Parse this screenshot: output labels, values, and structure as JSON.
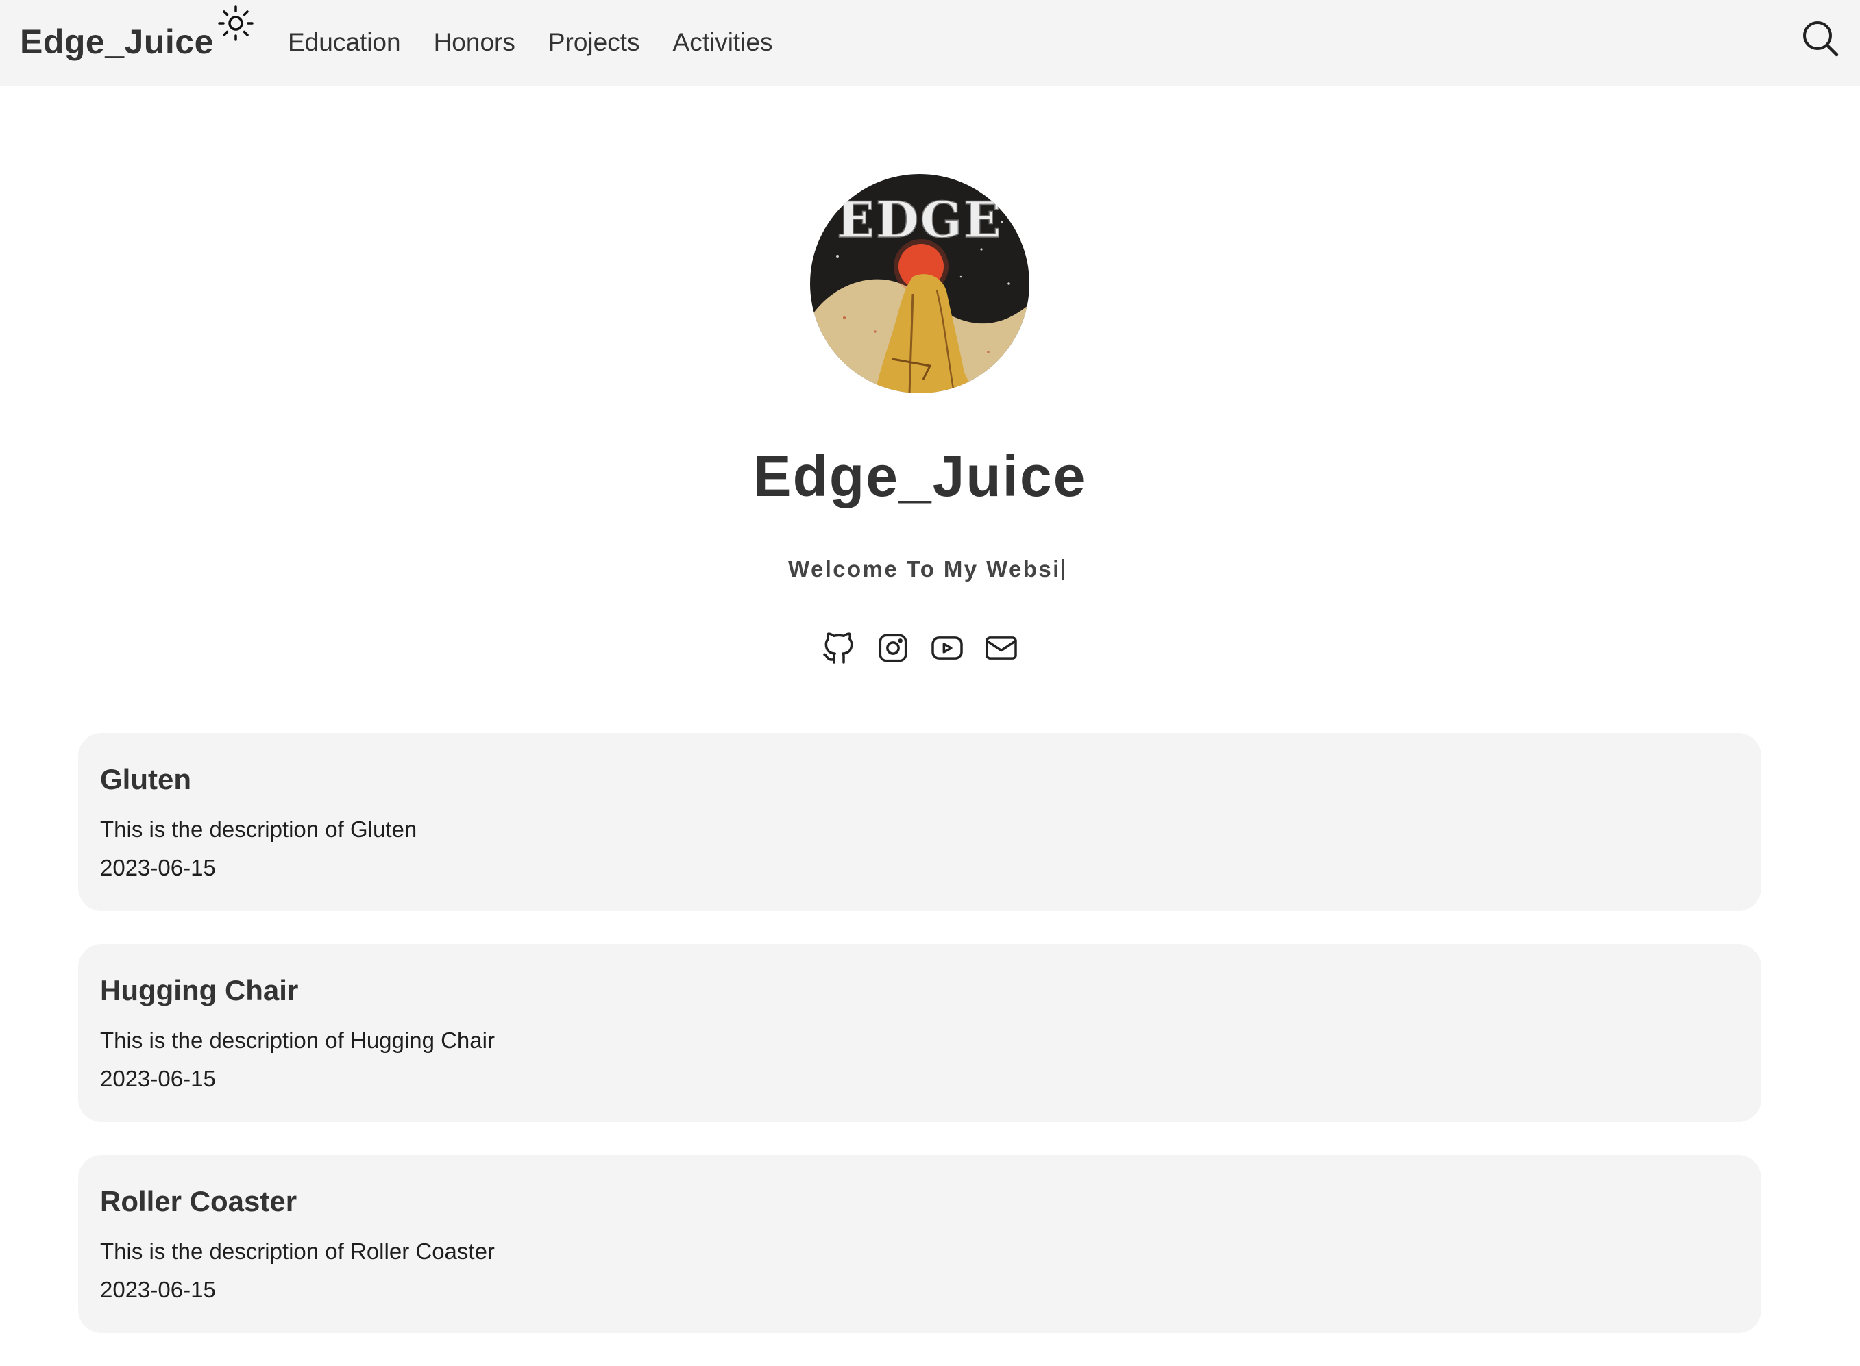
{
  "header": {
    "brand": "Edge_Juice",
    "theme_icon": "sun-icon",
    "nav": [
      {
        "label": "Education"
      },
      {
        "label": "Honors"
      },
      {
        "label": "Projects"
      },
      {
        "label": "Activities"
      }
    ],
    "search_icon": "search-icon"
  },
  "profile": {
    "avatar_text": "EDGE",
    "name": "Edge_Juice",
    "subtitle": "Welcome To My Websi",
    "social": [
      {
        "icon": "github-icon"
      },
      {
        "icon": "instagram-icon"
      },
      {
        "icon": "youtube-icon"
      },
      {
        "icon": "email-icon"
      }
    ]
  },
  "posts": [
    {
      "title": "Gluten",
      "description": "This is the description of Gluten",
      "date": "2023-06-15"
    },
    {
      "title": "Hugging Chair",
      "description": "This is the description of Hugging Chair",
      "date": "2023-06-15"
    },
    {
      "title": "Roller Coaster",
      "description": "This is the description of Roller Coaster",
      "date": "2023-06-15"
    }
  ],
  "colors": {
    "header_bg": "#f4f4f4",
    "card_bg": "#f4f4f4",
    "text": "#333333"
  }
}
